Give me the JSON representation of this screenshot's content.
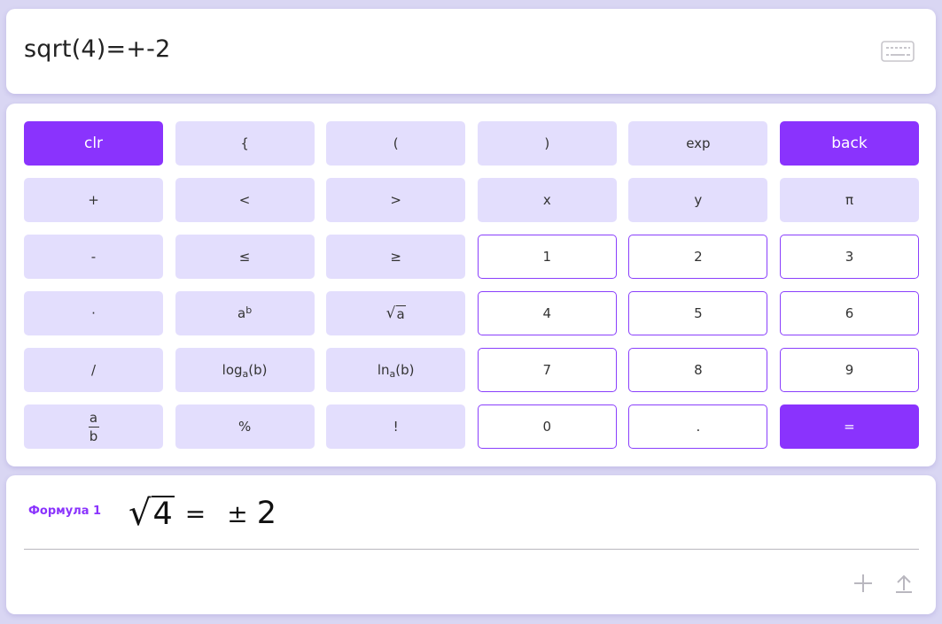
{
  "display": {
    "expression": "sqrt(4)=+-2",
    "keyboard_icon": "keyboard-icon"
  },
  "keypad": {
    "rows": [
      [
        {
          "label": "clr",
          "style": "primary",
          "name": "clear-button"
        },
        {
          "label": "{",
          "style": "op",
          "name": "left-brace-button"
        },
        {
          "label": "(",
          "style": "op",
          "name": "left-paren-button"
        },
        {
          "label": ")",
          "style": "op",
          "name": "right-paren-button"
        },
        {
          "label": "exp",
          "style": "op",
          "name": "exp-button"
        },
        {
          "label": "back",
          "style": "primary",
          "name": "backspace-button"
        }
      ],
      [
        {
          "label": "+",
          "style": "op",
          "name": "plus-button"
        },
        {
          "label": "<",
          "style": "op",
          "name": "less-than-button"
        },
        {
          "label": ">",
          "style": "op",
          "name": "greater-than-button"
        },
        {
          "label": "x",
          "style": "op",
          "name": "x-variable-button"
        },
        {
          "label": "y",
          "style": "op",
          "name": "y-variable-button"
        },
        {
          "label": "π",
          "style": "op",
          "name": "pi-button"
        }
      ],
      [
        {
          "label": "-",
          "style": "op",
          "name": "minus-button"
        },
        {
          "label": "≤",
          "style": "op",
          "name": "less-equal-button"
        },
        {
          "label": "≥",
          "style": "op",
          "name": "greater-equal-button"
        },
        {
          "label": "1",
          "style": "num",
          "name": "digit-1-button"
        },
        {
          "label": "2",
          "style": "num",
          "name": "digit-2-button"
        },
        {
          "label": "3",
          "style": "num",
          "name": "digit-3-button"
        }
      ],
      [
        {
          "label": "·",
          "style": "op",
          "name": "multiply-button"
        },
        {
          "label": "a",
          "sup": "b",
          "style": "op",
          "name": "power-button"
        },
        {
          "label": "a",
          "sqrt": true,
          "style": "op",
          "name": "sqrt-button"
        },
        {
          "label": "4",
          "style": "num",
          "name": "digit-4-button"
        },
        {
          "label": "5",
          "style": "num",
          "name": "digit-5-button"
        },
        {
          "label": "6",
          "style": "num",
          "name": "digit-6-button"
        }
      ],
      [
        {
          "label": "/",
          "style": "op",
          "name": "divide-button"
        },
        {
          "label": "log",
          "sub": "a",
          "suffix": "(b)",
          "style": "op",
          "name": "log-button"
        },
        {
          "label": "ln",
          "sub": "a",
          "suffix": "(b)",
          "style": "op",
          "name": "ln-button"
        },
        {
          "label": "7",
          "style": "num",
          "name": "digit-7-button"
        },
        {
          "label": "8",
          "style": "num",
          "name": "digit-8-button"
        },
        {
          "label": "9",
          "style": "num",
          "name": "digit-9-button"
        }
      ],
      [
        {
          "label": "a",
          "denominator": "b",
          "style": "op",
          "name": "fraction-button"
        },
        {
          "label": "%",
          "style": "op",
          "name": "percent-button"
        },
        {
          "label": "!",
          "style": "op",
          "name": "factorial-button"
        },
        {
          "label": "0",
          "style": "num",
          "name": "digit-0-button"
        },
        {
          "label": ".",
          "style": "num",
          "name": "decimal-point-button"
        },
        {
          "label": "=",
          "style": "eq",
          "name": "equals-button"
        }
      ]
    ]
  },
  "formula": {
    "label": "Формула 1",
    "radicand": "4",
    "equals": "=",
    "plus_minus": "±",
    "result": "2",
    "add_icon": "plus-icon",
    "upload_icon": "upload-icon"
  },
  "colors": {
    "accent": "#8a33fd",
    "key_light": "#e3defd",
    "background": "#d9d6f3"
  }
}
